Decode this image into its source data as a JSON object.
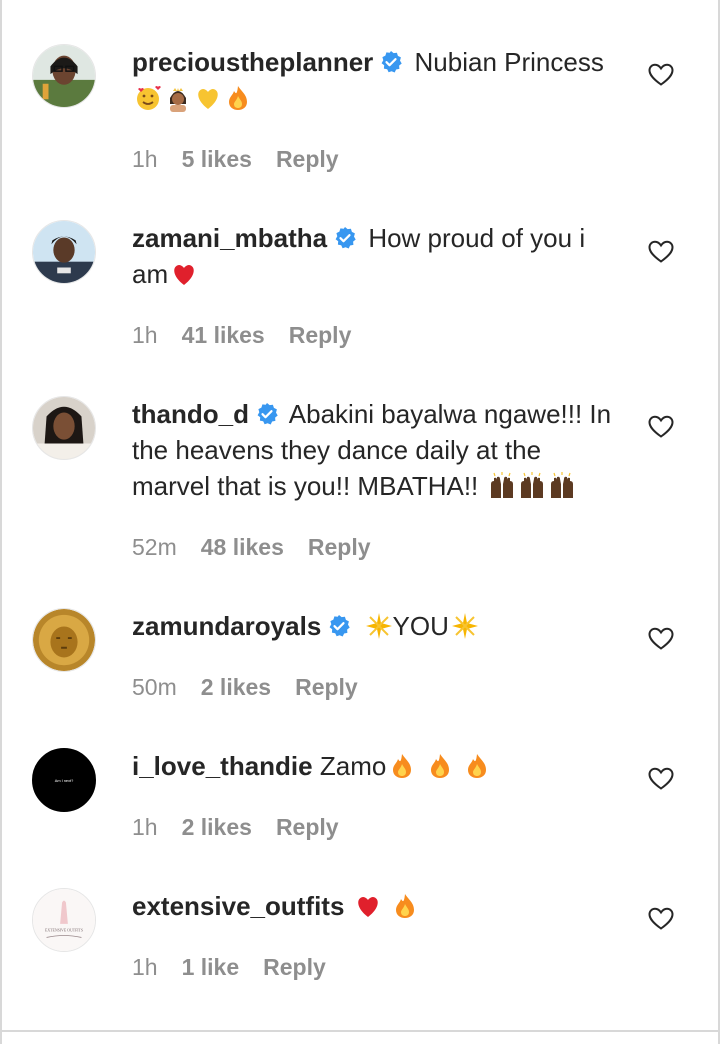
{
  "comments": [
    {
      "username": "precioustheplanner",
      "verified": true,
      "text": "Nubian Princess",
      "emojis": [
        "smiling-face-with-hearts",
        "princess",
        "yellow-heart",
        "fire"
      ],
      "time": "1h",
      "likes": "5 likes",
      "reply": "Reply"
    },
    {
      "username": "zamani_mbatha",
      "verified": true,
      "text": "How proud of you i am",
      "emojis": [
        "red-heart"
      ],
      "time": "1h",
      "likes": "41 likes",
      "reply": "Reply"
    },
    {
      "username": "thando_d",
      "verified": true,
      "text": "Abakini bayalwa ngawe!!! In the heavens they dance daily at the marvel that is you!! MBATHA!!",
      "emojis": [
        "raising-hands",
        "raising-hands",
        "raising-hands"
      ],
      "time": "52m",
      "likes": "48 likes",
      "reply": "Reply"
    },
    {
      "username": "zamundaroyals",
      "verified": true,
      "text_before": "",
      "text": "YOU",
      "emojis": [
        "sparkle",
        "sparkle"
      ],
      "time": "50m",
      "likes": "2 likes",
      "reply": "Reply"
    },
    {
      "username": "i_love_thandie",
      "verified": false,
      "text": "Zamo",
      "emojis": [
        "fire",
        "fire",
        "fire"
      ],
      "time": "1h",
      "likes": "2 likes",
      "reply": "Reply"
    },
    {
      "username": "extensive_outfits",
      "verified": false,
      "text": "",
      "emojis": [
        "red-heart",
        "fire"
      ],
      "time": "1h",
      "likes": "1 like",
      "reply": "Reply"
    }
  ],
  "avatar_labels": {
    "i_love_thandie": "Am I next?",
    "extensive_outfits": "EXTENSIVE OUTFITS"
  },
  "colors": {
    "text": "#262626",
    "meta": "#8e8e8e",
    "verified": "#3897f0",
    "heart_outline": "#262626"
  }
}
